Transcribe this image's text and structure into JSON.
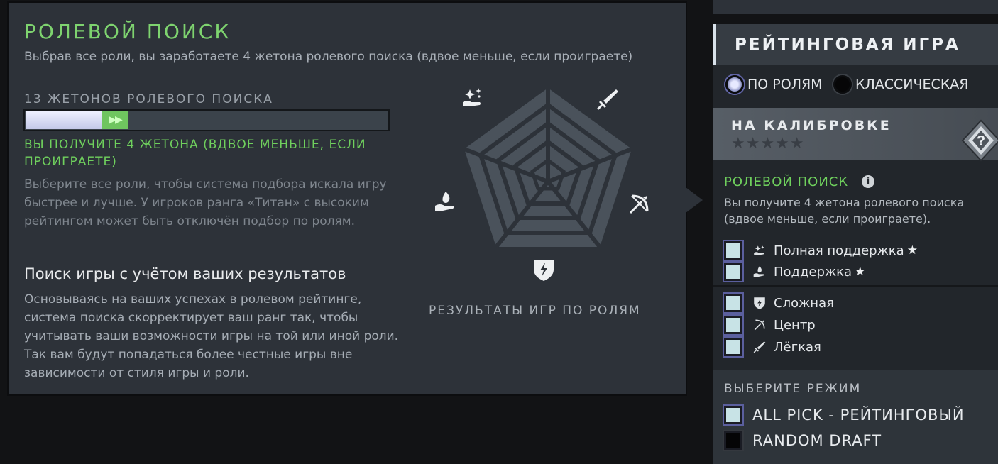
{
  "tooltip": {
    "title": "РОЛЕВОЙ ПОИСК",
    "subtitle": "Выбрав все роли, вы заработаете 4 жетона ролевого поиска (вдвое меньше, если проиграете)",
    "tokens_label": "13 ЖЕТОНОВ РОЛЕВОГО ПОИСКА",
    "progress": {
      "current_fraction": 0.21,
      "gain_fraction": 0.075,
      "gain_glyph": "▶▶"
    },
    "gain_text": "ВЫ ПОЛУЧИТЕ 4 ЖЕТОНА (ВДВОЕ МЕНЬШЕ, ЕСЛИ ПРОИГРАЕТЕ)",
    "hint_text": "Выберите все роли, чтобы система подбора искала игру быстрее и лучше. У игроков ранга «Титан» с высоким рейтингом может быть отключён подбор по ролям.",
    "section_title": "Поиск игры с учётом ваших результатов",
    "section_body": "Основываясь на ваших успехах в ролевом рейтинге, система поиска скорректирует ваш ранг так, чтобы учитывать ваши возможности игры на той или иной роли. Так вам будут попадаться более честные игры вне зависимости от стиля игры и роли.",
    "radar_caption": "РЕЗУЛЬТАТЫ ИГР ПО РОЛЯМ",
    "radar_roles": [
      "full-support-icon",
      "carry-sword-icon",
      "mid-bow-icon",
      "offlane-shield-icon",
      "support-hand-icon"
    ]
  },
  "panel": {
    "title": "РЕЙТИНГОВАЯ ИГРА",
    "modes": [
      {
        "label": "ПО РОЛЯМ",
        "selected": true
      },
      {
        "label": "КЛАССИЧЕСКАЯ",
        "selected": false
      }
    ],
    "calibration_title": "НА КАЛИБРОВКЕ",
    "calibration_stars": "★★★★★",
    "badge_glyph": "?",
    "role_search_title": "РОЛЕВОЙ ПОИСК",
    "info_glyph": "i",
    "role_search_text": "Вы получите 4 жетона ролевого поиска (вдвое меньше, если проиграете).",
    "roles": [
      {
        "name": "Полная поддержка",
        "icon": "full-support-icon",
        "checked": true,
        "star": "★"
      },
      {
        "name": "Поддержка",
        "icon": "support-icon",
        "checked": true,
        "star": "★"
      },
      {
        "name": "Сложная",
        "icon": "offlane-icon",
        "checked": true,
        "star": ""
      },
      {
        "name": "Центр",
        "icon": "mid-icon",
        "checked": true,
        "star": ""
      },
      {
        "name": "Лёгкая",
        "icon": "carry-icon",
        "checked": true,
        "star": ""
      }
    ],
    "mode_section_title": "ВЫБЕРИТЕ РЕЖИМ",
    "game_modes": [
      {
        "label": "ALL PICK - РЕЙТИНГОВЫЙ",
        "checked": true
      },
      {
        "label": "RANDOM DRAFT",
        "checked": false
      }
    ]
  },
  "colors": {
    "accent_green": "#6fd05d",
    "panel_bg": "#2d3239",
    "checkbox_on": "#c8e3e6"
  }
}
